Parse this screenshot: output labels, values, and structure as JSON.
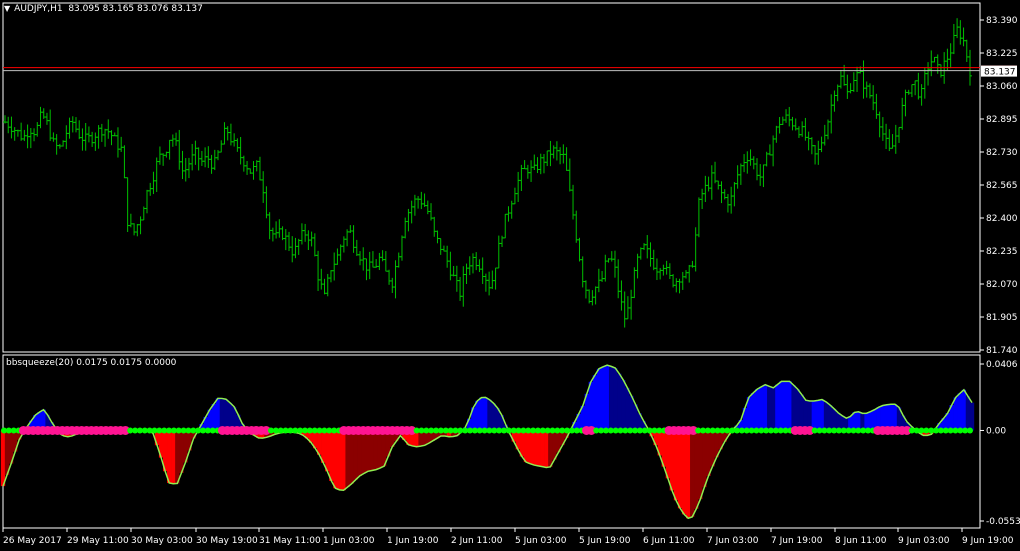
{
  "chart_title": {
    "symbol_tf": "AUDJPY,H1",
    "ohlc": "83.095 83.165 83.076 83.137"
  },
  "indicator_title": "bbsqueeze(20) 0.0175 0.0175 0.0000",
  "colors": {
    "background": "#000000",
    "candle": "#00c000",
    "grid_frame": "#ffffff",
    "price_line": "#ff0000",
    "bid_line": "#c0c0c0",
    "positive_hist": "#0000ff",
    "positive_hist_dark": "#00008b",
    "negative_hist": "#ff0000",
    "negative_hist_dark": "#8b0000",
    "outline": "#90ee50",
    "squeeze_on": "#ff1493",
    "squeeze_off": "#00ff00"
  },
  "chart_data": [
    {
      "type": "bar",
      "title": "AUDJPY,H1",
      "ylim": [
        81.74,
        83.44
      ],
      "y_ticks": [
        "83.390",
        "83.225",
        "83.060",
        "82.895",
        "82.730",
        "82.565",
        "82.400",
        "82.235",
        "82.070",
        "81.905",
        "81.740"
      ],
      "current_price": 83.137,
      "current_price_label": "83.137",
      "red_line_price": 83.152,
      "x_tick_labels": [
        "26 May 2017",
        "29 May 11:00",
        "30 May 03:00",
        "30 May 19:00",
        "31 May 11:00",
        "1 Jun 03:00",
        "1 Jun 19:00",
        "2 Jun 11:00",
        "5 Jun 03:00",
        "5 Jun 19:00",
        "6 Jun 11:00",
        "7 Jun 03:00",
        "7 Jun 19:00",
        "8 Jun 11:00",
        "9 Jun 03:00",
        "9 Jun 19:00"
      ],
      "close_path": [
        82.88,
        82.86,
        82.83,
        82.8,
        82.85,
        82.83,
        82.92,
        82.86,
        82.76,
        82.75,
        82.83,
        82.88,
        82.82,
        82.79,
        82.8,
        82.83,
        82.85,
        82.83,
        82.78,
        82.74,
        82.37,
        82.33,
        82.4,
        82.52,
        82.6,
        82.7,
        82.73,
        82.82,
        82.75,
        82.62,
        82.68,
        82.72,
        82.68,
        82.7,
        82.66,
        82.75,
        82.85,
        82.78,
        82.72,
        82.68,
        82.63,
        82.66,
        82.55,
        82.35,
        82.3,
        82.33,
        82.28,
        82.22,
        82.3,
        82.33,
        82.28,
        82.1,
        82.0,
        82.15,
        82.2,
        82.3,
        82.34,
        82.26,
        82.2,
        82.15,
        82.15,
        82.2,
        82.12,
        82.08,
        82.22,
        82.4,
        82.45,
        82.5,
        82.48,
        82.42,
        82.3,
        82.25,
        82.18,
        82.1,
        82.02,
        82.15,
        82.2,
        82.18,
        82.12,
        82.05,
        82.2,
        82.35,
        82.45,
        82.55,
        82.62,
        82.65,
        82.63,
        82.68,
        82.7,
        82.74,
        82.72,
        82.7,
        82.5,
        82.3,
        82.1,
        82.0,
        82.05,
        82.08,
        82.2,
        82.18,
        82.0,
        81.88,
        82.05,
        82.2,
        82.25,
        82.2,
        82.15,
        82.18,
        82.1,
        82.08,
        82.12,
        82.1,
        82.2,
        82.5,
        82.55,
        82.6,
        82.55,
        82.5,
        82.48,
        82.6,
        82.68,
        82.72,
        82.65,
        82.6,
        82.7,
        82.8,
        82.88,
        82.9,
        82.88,
        82.85,
        82.82,
        82.75,
        82.7,
        82.8,
        82.9,
        83.05,
        83.1,
        83.02,
        83.1,
        83.12,
        83.05,
        83.0,
        82.92,
        82.8,
        82.72,
        82.82,
        82.95,
        83.05,
        83.08,
        83.0,
        83.15,
        83.2,
        83.12,
        83.18,
        83.25,
        83.35,
        83.28,
        83.14
      ]
    },
    {
      "type": "bar",
      "title": "bbsqueeze(20)",
      "series": [
        {
          "name": "bbsqueeze(20)",
          "values": [
            0.0175,
            0.0175,
            0.0
          ]
        }
      ],
      "ylim": [
        -0.0553,
        0.0406
      ],
      "y_ticks": [
        "0.0406",
        "0.00",
        "-0.0553"
      ],
      "momentum_path": [
        -0.034,
        -0.02,
        -0.005,
        0.003,
        0.01,
        0.013,
        0.004,
        -0.003,
        -0.004,
        -0.002,
        -0.001,
        -0.001,
        -0.001,
        -0.001,
        -0.002,
        -0.001,
        0.0,
        0.0,
        0.0,
        -0.015,
        -0.032,
        -0.033,
        -0.02,
        -0.005,
        0.004,
        0.013,
        0.02,
        0.019,
        0.014,
        0.003,
        -0.002,
        -0.005,
        -0.004,
        -0.002,
        -0.001,
        -0.001,
        -0.002,
        -0.006,
        -0.013,
        -0.023,
        -0.035,
        -0.037,
        -0.033,
        -0.028,
        -0.025,
        -0.024,
        -0.022,
        -0.01,
        -0.003,
        -0.009,
        -0.01,
        -0.009,
        -0.006,
        -0.003,
        -0.004,
        -0.003,
        0.003,
        0.017,
        0.021,
        0.018,
        0.012,
        0.0,
        -0.01,
        -0.019,
        -0.021,
        -0.022,
        -0.023,
        -0.014,
        -0.005,
        0.005,
        0.015,
        0.03,
        0.038,
        0.04,
        0.038,
        0.03,
        0.02,
        0.009,
        0.0,
        -0.011,
        -0.025,
        -0.04,
        -0.05,
        -0.055,
        -0.045,
        -0.03,
        -0.018,
        -0.008,
        0.0,
        0.005,
        0.02,
        0.025,
        0.028,
        0.026,
        0.03,
        0.03,
        0.025,
        0.018,
        0.018,
        0.019,
        0.015,
        0.01,
        0.007,
        0.012,
        0.01,
        0.012,
        0.015,
        0.016,
        0.016,
        0.006,
        0.001,
        -0.003,
        -0.003,
        0.004,
        0.01,
        0.02,
        0.025,
        0.017
      ],
      "squeeze_on_ranges": [
        [
          0.02,
          0.127
        ],
        [
          0.222,
          0.275
        ],
        [
          0.348,
          0.425
        ],
        [
          0.6,
          0.612
        ],
        [
          0.684,
          0.714
        ],
        [
          0.817,
          0.837
        ],
        [
          0.902,
          0.937
        ]
      ]
    }
  ]
}
